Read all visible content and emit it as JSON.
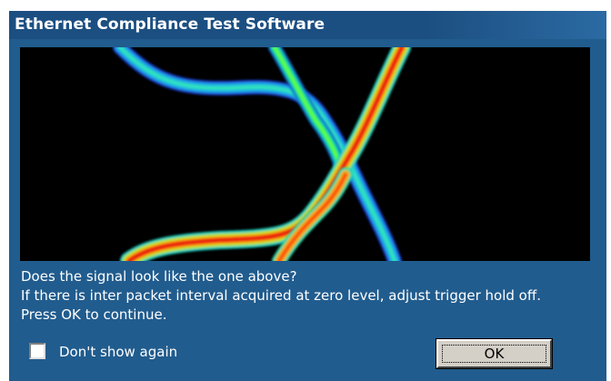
{
  "window": {
    "title": "Ethernet Compliance Test Software"
  },
  "message": {
    "line1": "Does the signal look like the one above?",
    "line2": "If there is inter packet interval acquired at zero level, adjust trigger hold off.",
    "line3": "Press OK to continue."
  },
  "checkbox": {
    "label": "Don't show again",
    "checked": false
  },
  "buttons": {
    "ok_label": "OK"
  },
  "colors": {
    "dialog_bg": "#215c8e",
    "titlebar_bg": "#1c4f81",
    "scope_bg": "#000000"
  }
}
